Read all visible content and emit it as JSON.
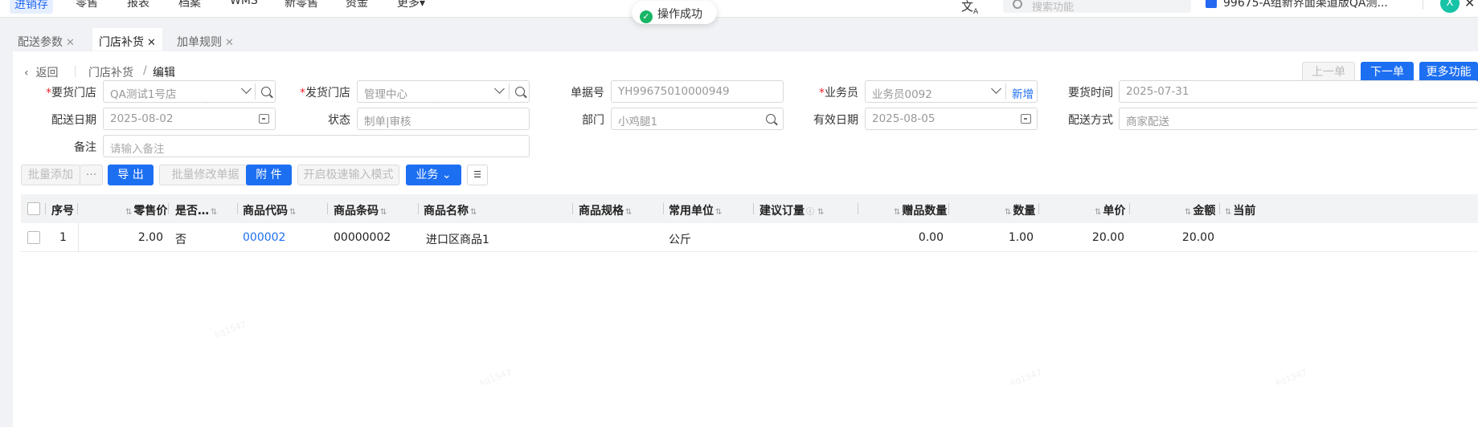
{
  "topnav": {
    "menus": [
      "进销存",
      "零售",
      "报表",
      "档案",
      "WMS",
      "新零售",
      "资金",
      "更多"
    ],
    "search_placeholder": "搜索功能",
    "store": "99675-A组新界面渠道版QA测...",
    "avatar": "X",
    "translate_icon": "translate-icon"
  },
  "toast": {
    "text": "操作成功",
    "icon": "check-circle-icon"
  },
  "tabs": [
    {
      "label": "配送参数",
      "active": false
    },
    {
      "label": "门店补货",
      "active": true
    },
    {
      "label": "加单规则",
      "active": false
    }
  ],
  "breadcrumb": {
    "back": "返回",
    "parent": "门店补货",
    "current": "编辑"
  },
  "header_buttons": {
    "prev": "上一单",
    "next": "下一单",
    "more": "更多功能"
  },
  "form": {
    "request_store": {
      "label": "要货门店",
      "value": "QA测试1号店"
    },
    "ship_store": {
      "label": "发货门店",
      "value": "管理中心"
    },
    "doc_no": {
      "label": "单据号",
      "value": "YH99675010000949"
    },
    "salesman": {
      "label": "业务员",
      "value": "业务员0092",
      "add": "新增"
    },
    "request_time": {
      "label": "要货时间",
      "value": "2025-07-31"
    },
    "delivery_date": {
      "label": "配送日期",
      "value": "2025-08-02"
    },
    "status": {
      "label": "状态",
      "value": "制单|审核"
    },
    "department": {
      "label": "部门",
      "value": "小鸡腿1"
    },
    "valid_date": {
      "label": "有效日期",
      "value": "2025-08-05"
    },
    "delivery_method": {
      "label": "配送方式",
      "value": "商家配送"
    },
    "remark": {
      "label": "备注",
      "placeholder": "请输入备注"
    }
  },
  "toolbar": {
    "batch_add": "批量添加",
    "more": "···",
    "export": "导 出",
    "batch_modify": "批量修改单据",
    "attachment": "附 件",
    "quick_input": "开启极速输入模式",
    "business": "业务"
  },
  "table": {
    "columns": [
      "序号",
      "零售价",
      "是否…",
      "商品代码",
      "商品条码",
      "商品名称",
      "商品规格",
      "常用单位",
      "建议订量",
      "赠品数量",
      "数量",
      "单价",
      "金额",
      "当前"
    ],
    "rows": [
      {
        "index": "1",
        "retail_price": "2.00",
        "flag": "否",
        "code": "000002",
        "barcode": "00000002",
        "name": "进口区商品1",
        "spec": "",
        "unit": "公斤",
        "suggested": "",
        "gift_qty": "0.00",
        "qty": "1.00",
        "unit_price": "20.00",
        "amount": "20.00"
      }
    ]
  },
  "watermark": "kq1547"
}
